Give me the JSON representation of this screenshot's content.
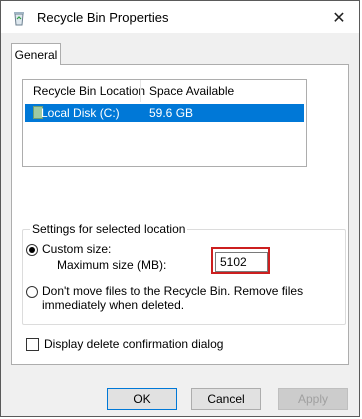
{
  "window": {
    "title": "Recycle Bin Properties",
    "app_icon": "recycle-bin-icon",
    "close_glyph": "✕"
  },
  "tabs": [
    {
      "label": "General",
      "selected": true
    }
  ],
  "list": {
    "columns": [
      "Recycle Bin Location",
      "Space Available"
    ],
    "rows": [
      {
        "location": "Local Disk (C:)",
        "space": "59.6 GB",
        "icon": "drive-icon",
        "selected": true
      }
    ]
  },
  "settings": {
    "group_label": "Settings for selected location",
    "custom_size_label": "Custom size:",
    "custom_size_selected": true,
    "max_size_label": "Maximum size (MB):",
    "max_size_value": "5102",
    "dont_move_label": "Don't move files to the Recycle Bin. Remove files immediately when deleted.",
    "dont_move_selected": false
  },
  "confirm": {
    "label": "Display delete confirmation dialog",
    "checked": false
  },
  "buttons": {
    "ok": "OK",
    "cancel": "Cancel",
    "apply": "Apply"
  },
  "colors": {
    "selection": "#0078d7",
    "highlight_box": "#cc1f1f"
  }
}
